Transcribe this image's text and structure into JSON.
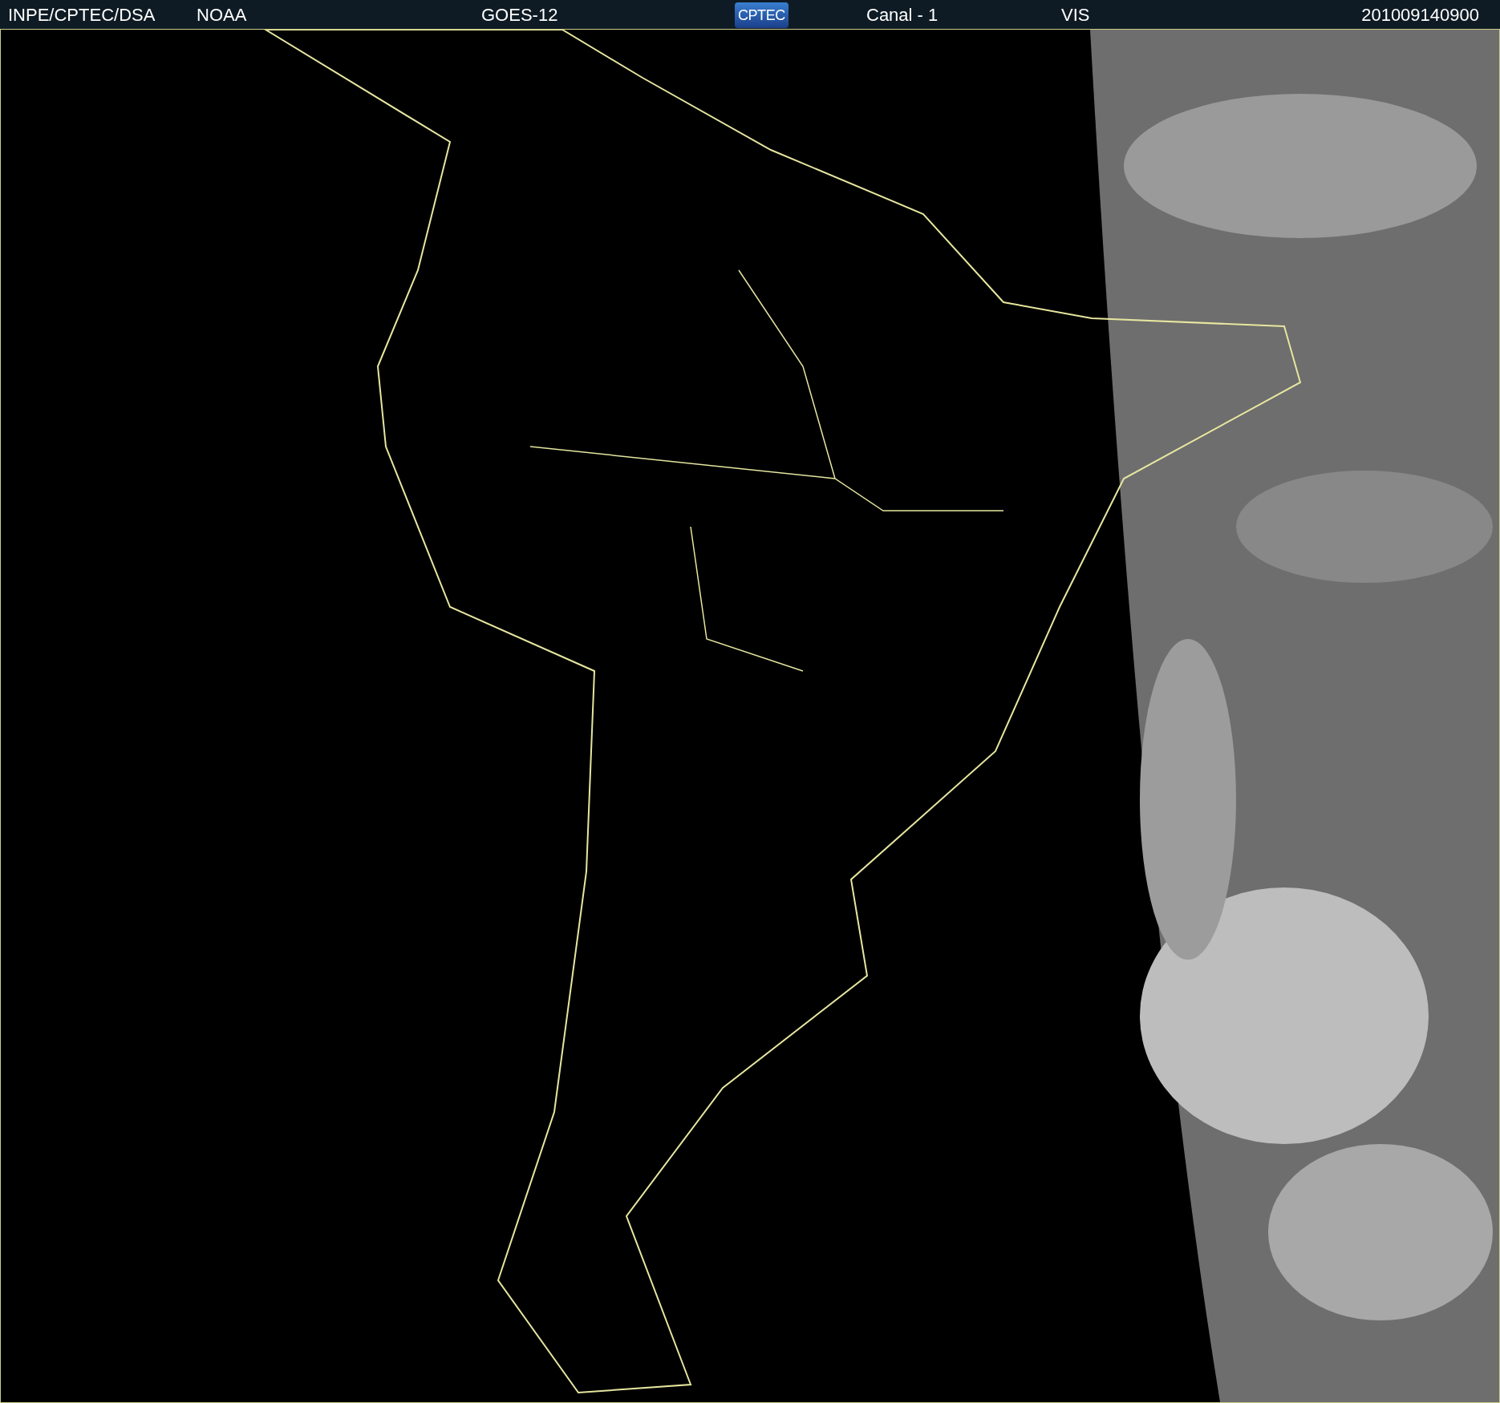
{
  "header": {
    "items": [
      {
        "kind": "text",
        "text": "INPE/CPTEC/DSA"
      },
      {
        "kind": "text",
        "text": "NOAA"
      },
      {
        "kind": "text",
        "text": "GOES-12"
      },
      {
        "kind": "logo",
        "text": "CPTEC"
      },
      {
        "kind": "text",
        "text": "Canal - 1"
      },
      {
        "kind": "text",
        "text": "VIS"
      },
      {
        "kind": "text",
        "text": "201009140900"
      }
    ]
  }
}
